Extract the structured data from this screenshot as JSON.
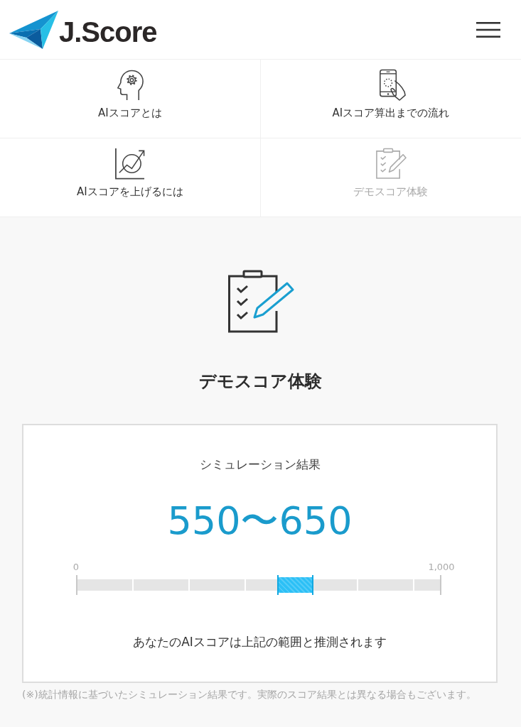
{
  "header": {
    "logo_text": "J.Score"
  },
  "nav_items": [
    {
      "label": "AIスコアとは",
      "selected": false
    },
    {
      "label": "AIスコア算出までの流れ",
      "selected": false
    },
    {
      "label": "AIスコアを上げるには",
      "selected": false
    },
    {
      "label": "デモスコア体験",
      "selected": true
    }
  ],
  "page_title": "デモスコア体験",
  "result_card": {
    "heading": "シミュレーション結果",
    "score_range": "550〜650",
    "range_bar": {
      "min_label": "0",
      "max_label": "1,000",
      "bounds": [
        {
          "level": 0.55
        },
        {
          "level": 0.65
        }
      ]
    },
    "message": "あなたのAIスコアは上記の範囲と推測されます"
  },
  "footnote": "(※)統計情報に基づいたシミュレーション結果です。実際のスコア結果とは異なる場合もございます。"
}
